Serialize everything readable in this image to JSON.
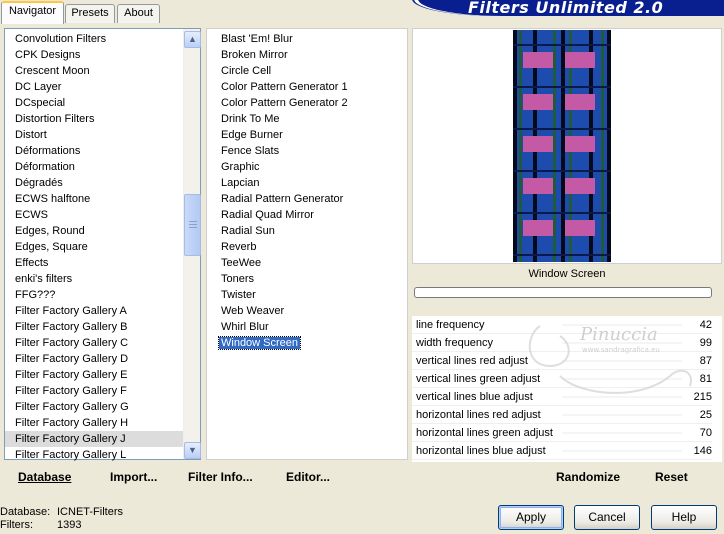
{
  "brand": "Filters Unlimited 2.0",
  "tabs": {
    "navigator": "Navigator",
    "presets": "Presets",
    "about": "About"
  },
  "categories": [
    "Convolution Filters",
    "CPK Designs",
    "Crescent Moon",
    "DC Layer",
    "DCspecial",
    "Distortion Filters",
    "Distort",
    "Déformations",
    "Déformation",
    "Dégradés",
    "ECWS halftone",
    "ECWS",
    "Edges, Round",
    "Edges, Square",
    "Effects",
    "enki's filters",
    "FFG???",
    "Filter Factory Gallery A",
    "Filter Factory Gallery B",
    "Filter Factory Gallery C",
    "Filter Factory Gallery D",
    "Filter Factory Gallery E",
    "Filter Factory Gallery F",
    "Filter Factory Gallery G",
    "Filter Factory Gallery H",
    "Filter Factory Gallery J",
    "Filter Factory Gallery L"
  ],
  "selected_category": "Filter Factory Gallery J",
  "filters": [
    "Blast 'Em! Blur",
    "Broken Mirror",
    "Circle Cell",
    "Color Pattern Generator 1",
    "Color Pattern Generator 2",
    "Drink To Me",
    "Edge Burner",
    "Fence Slats",
    "Graphic",
    "Lapcian",
    "Radial Pattern Generator",
    "Radial Quad Mirror",
    "Radial Sun",
    "Reverb",
    "TeeWee",
    "Toners",
    "Twister",
    "Web Weaver",
    "Whirl Blur",
    "Window Screen"
  ],
  "selected_filter": "Window Screen",
  "preview_label": "Window Screen",
  "params": [
    {
      "name": "line frequency",
      "value": "42"
    },
    {
      "name": "width frequency",
      "value": "99"
    },
    {
      "name": "vertical lines red adjust",
      "value": "87"
    },
    {
      "name": "vertical lines green adjust",
      "value": "81"
    },
    {
      "name": "vertical lines blue adjust",
      "value": "215"
    },
    {
      "name": "horizontal lines red adjust",
      "value": "25"
    },
    {
      "name": "horizontal lines green adjust",
      "value": "70"
    },
    {
      "name": "horizontal lines blue adjust",
      "value": "146"
    }
  ],
  "bottom": {
    "database": "Database",
    "import": "Import...",
    "filter_info": "Filter Info...",
    "editor": "Editor...",
    "randomize": "Randomize",
    "reset": "Reset"
  },
  "status": {
    "database_label": "Database:",
    "database_value": "ICNET-Filters",
    "filters_label": "Filters:",
    "filters_value": "1393"
  },
  "buttons": {
    "apply": "Apply",
    "cancel": "Cancel",
    "help": "Help"
  },
  "watermark": {
    "name": "Pinuccia",
    "site": "www.sandragrafica.eu"
  },
  "colors": {
    "selection": "#316ac5",
    "accent_tab": "#ffc83c",
    "brand_bg": "#0a1f8f",
    "preview_blue": "#1e4cae",
    "preview_pink": "#c45aa6",
    "preview_green": "#1f5b3a"
  }
}
